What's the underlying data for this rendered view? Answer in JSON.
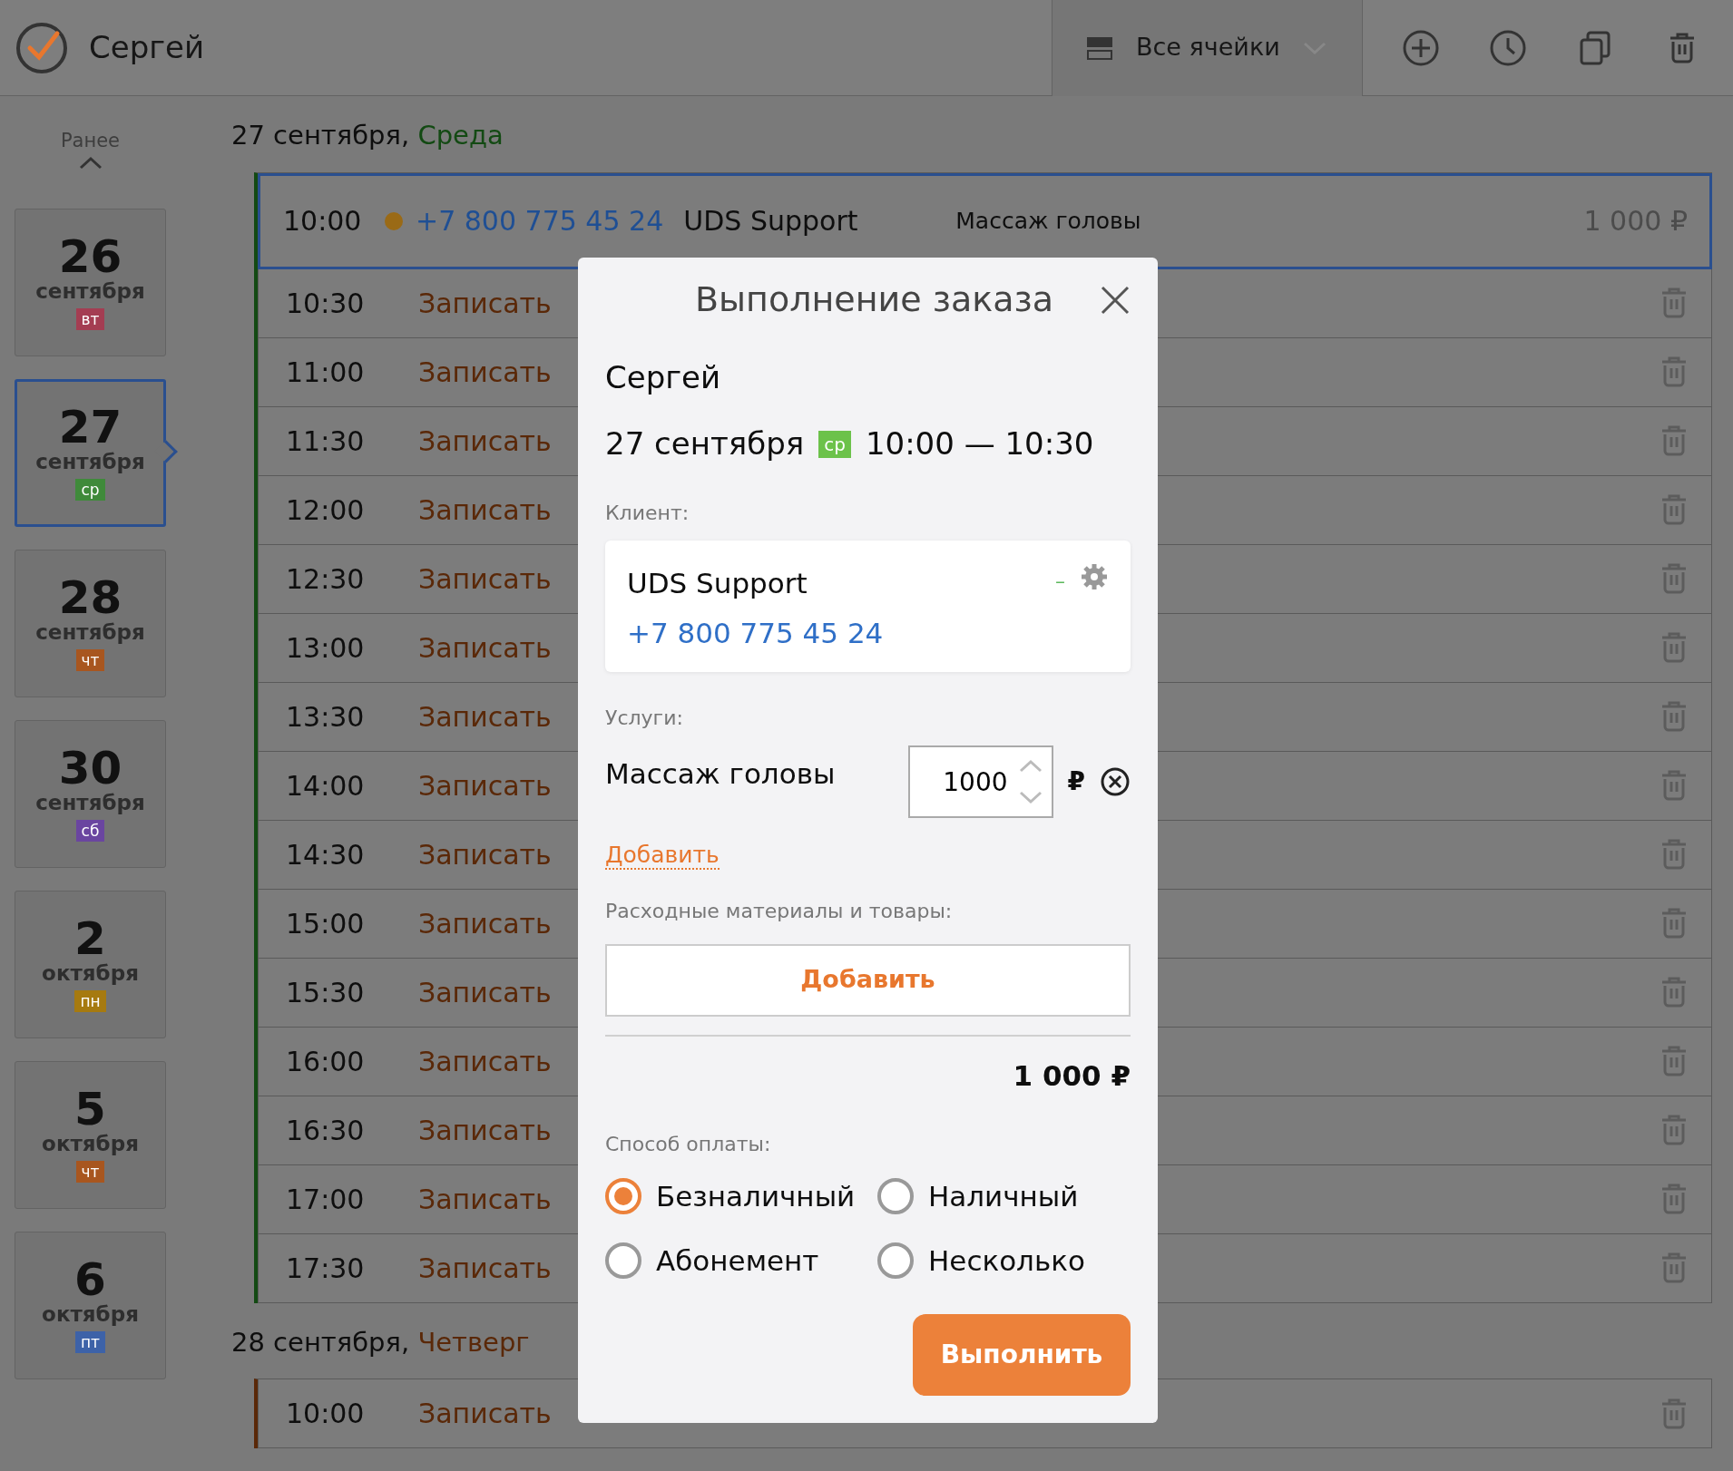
{
  "header": {
    "user": "Сергей",
    "filter": "Все ячейки"
  },
  "sidebar": {
    "earlier": "Ранее",
    "days": [
      {
        "day": "26",
        "month": "сентября",
        "weekday": "вт",
        "color": "#a43d52",
        "selected": false
      },
      {
        "day": "27",
        "month": "сентября",
        "weekday": "ср",
        "color": "#3f8a3a",
        "selected": true
      },
      {
        "day": "28",
        "month": "сентября",
        "weekday": "чт",
        "color": "#a8561f",
        "selected": false
      },
      {
        "day": "30",
        "month": "сентября",
        "weekday": "сб",
        "color": "#6a45a0",
        "selected": false
      },
      {
        "day": "2",
        "month": "октября",
        "weekday": "пн",
        "color": "#a67a10",
        "selected": false
      },
      {
        "day": "5",
        "month": "октября",
        "weekday": "чт",
        "color": "#a8561f",
        "selected": false
      },
      {
        "day": "6",
        "month": "октября",
        "weekday": "пт",
        "color": "#3d62a8",
        "selected": false
      }
    ]
  },
  "schedule": [
    {
      "date": "27 сентября,",
      "weekday": "Среда",
      "color": "#134a13",
      "slots": [
        {
          "kind": "booked",
          "time": "10:00",
          "color": "#9a6a16",
          "phone": "+7 800 775 45 24",
          "client": "UDS Support",
          "service": "Массаж головы",
          "price": "1 000 ₽",
          "selected": true
        },
        {
          "kind": "free",
          "time": "10:30",
          "action": "Записать",
          "selected": false
        },
        {
          "kind": "free",
          "time": "11:00",
          "action": "Записать",
          "selected": false
        },
        {
          "kind": "free",
          "time": "11:30",
          "action": "Записать",
          "selected": false
        },
        {
          "kind": "free",
          "time": "12:00",
          "action": "Записать",
          "selected": false
        },
        {
          "kind": "free",
          "time": "12:30",
          "action": "Записать",
          "selected": false
        },
        {
          "kind": "free",
          "time": "13:00",
          "action": "Записать",
          "selected": false
        },
        {
          "kind": "free",
          "time": "13:30",
          "action": "Записать",
          "selected": false
        },
        {
          "kind": "free",
          "time": "14:00",
          "action": "Записать",
          "selected": false
        },
        {
          "kind": "free",
          "time": "14:30",
          "action": "Записать",
          "selected": false
        },
        {
          "kind": "free",
          "time": "15:00",
          "action": "Записать",
          "selected": false
        },
        {
          "kind": "free",
          "time": "15:30",
          "action": "Записать",
          "selected": false
        },
        {
          "kind": "free",
          "time": "16:00",
          "action": "Записать",
          "selected": false
        },
        {
          "kind": "free",
          "time": "16:30",
          "action": "Записать",
          "selected": false
        },
        {
          "kind": "free",
          "time": "17:00",
          "action": "Записать",
          "selected": false
        },
        {
          "kind": "free",
          "time": "17:30",
          "action": "Записать",
          "selected": false
        }
      ]
    },
    {
      "date": "28 сентября,",
      "weekday": "Четверг",
      "color": "#5a2808",
      "slots": [
        {
          "kind": "free",
          "time": "10:00",
          "action": "Записать",
          "selected": false
        }
      ]
    }
  ],
  "modal": {
    "title": "Выполнение заказа",
    "master": "Сергей",
    "date": {
      "date": "27 сентября",
      "weekday": "ср",
      "color": "#6cc24a",
      "time": "10:00 — 10:30"
    },
    "client_label": "Клиент:",
    "client": {
      "name": "UDS Support",
      "balance": "–",
      "phone": "+7 800 775 45 24"
    },
    "services_label": "Услуги:",
    "services": [
      {
        "name": "Массаж головы",
        "price": "1000",
        "currency": "₽"
      }
    ],
    "add_service": "Добавить",
    "materials_label": "Расходные материалы и товары:",
    "add_material": "Добавить",
    "total": "1 000 ₽",
    "payment_label": "Способ оплаты:",
    "payment_options": [
      {
        "label": "Безналичный",
        "selected": true
      },
      {
        "label": "Наличный",
        "selected": false
      },
      {
        "label": "Абонемент",
        "selected": false
      },
      {
        "label": "Несколько",
        "selected": false
      }
    ],
    "submit": "Выполнить"
  }
}
